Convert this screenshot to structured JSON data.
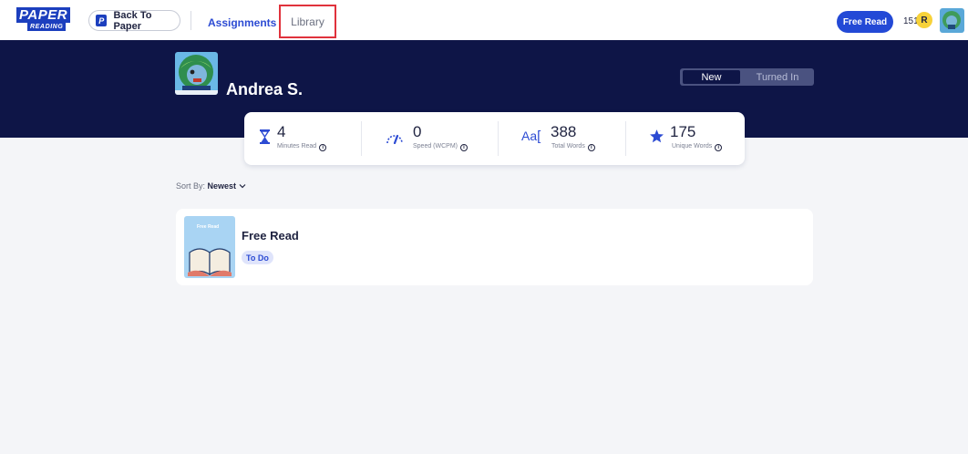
{
  "header": {
    "logo_line1": "PAPER",
    "logo_line2": "READING",
    "back_label": "Back To Paper",
    "back_icon_letter": "P",
    "nav": {
      "assignments": "Assignments",
      "library": "Library"
    },
    "free_read_label": "Free Read",
    "points": "151",
    "points_badge": "R"
  },
  "profile": {
    "name": "Andrea S.",
    "toggle": {
      "new": "New",
      "turned_in": "Turned In",
      "selected": "New"
    }
  },
  "stats": [
    {
      "icon": "hourglass-icon",
      "value": "4",
      "label": "Minutes Read"
    },
    {
      "icon": "speedometer-icon",
      "value": "0",
      "label": "Speed (WCPM)"
    },
    {
      "icon": "text-size-icon",
      "value": "388",
      "label": "Total Words"
    },
    {
      "icon": "star-icon",
      "value": "175",
      "label": "Unique Words"
    }
  ],
  "stat_icon_text": "Aa",
  "sort": {
    "prefix": "Sort By:",
    "value": "Newest"
  },
  "assignments": [
    {
      "title": "Free Read",
      "thumb_label": "Free Read",
      "status": "To Do"
    }
  ],
  "colors": {
    "brand": "#1c3fbe",
    "accent": "#2349d6",
    "banner": "#0e1547",
    "highlight": "#e0323c"
  }
}
